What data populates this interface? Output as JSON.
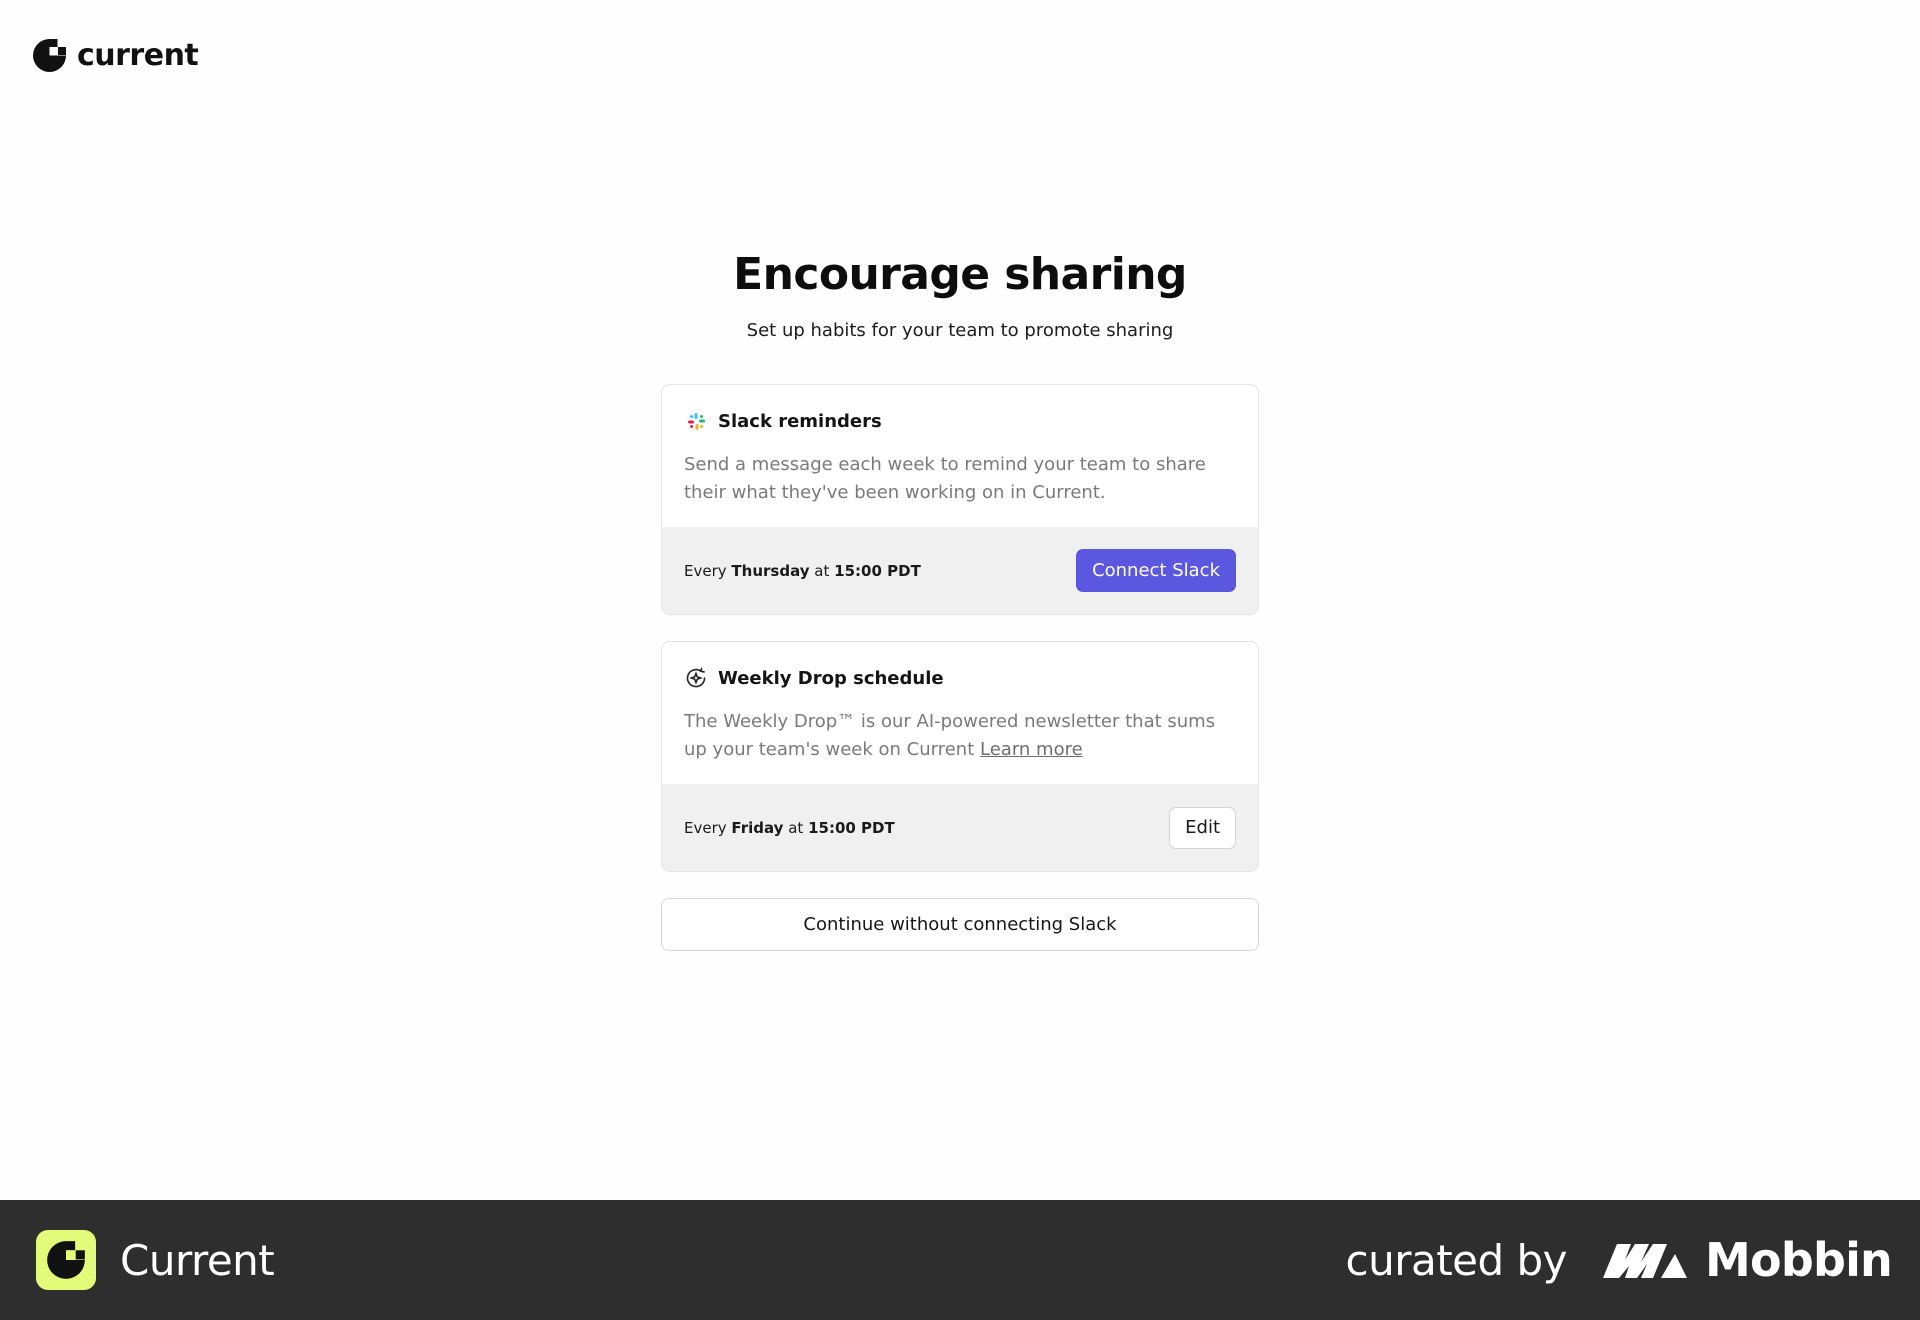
{
  "header": {
    "logo_text": "current",
    "logo_icon": "current-logo-icon"
  },
  "main": {
    "title": "Encourage sharing",
    "subtitle": "Set up habits for your team to promote sharing"
  },
  "cards": [
    {
      "icon": "slack-icon",
      "title": "Slack reminders",
      "description": "Send a message each week to remind your team to share their what they've been working on in Current.",
      "schedule_prefix": "Every",
      "schedule_day": "Thursday",
      "schedule_mid": "at",
      "schedule_time": "15:00 PDT",
      "action_label": "Connect Slack"
    },
    {
      "icon": "sparkle-refresh-icon",
      "title": "Weekly Drop schedule",
      "description": "The Weekly Drop™ is our AI-powered newsletter that sums up your team's week on Current",
      "link_label": "Learn more",
      "schedule_prefix": "Every",
      "schedule_day": "Friday",
      "schedule_mid": "at",
      "schedule_time": "15:00 PDT",
      "action_label": "Edit"
    }
  ],
  "continue_label": "Continue without connecting Slack",
  "footer": {
    "app_name": "Current",
    "curated_by": "curated by",
    "brand": "Mobbin"
  },
  "colors": {
    "primary": "#5b57e0",
    "badge": "#e4fb7a",
    "footer_bg": "#2e2e2e"
  }
}
